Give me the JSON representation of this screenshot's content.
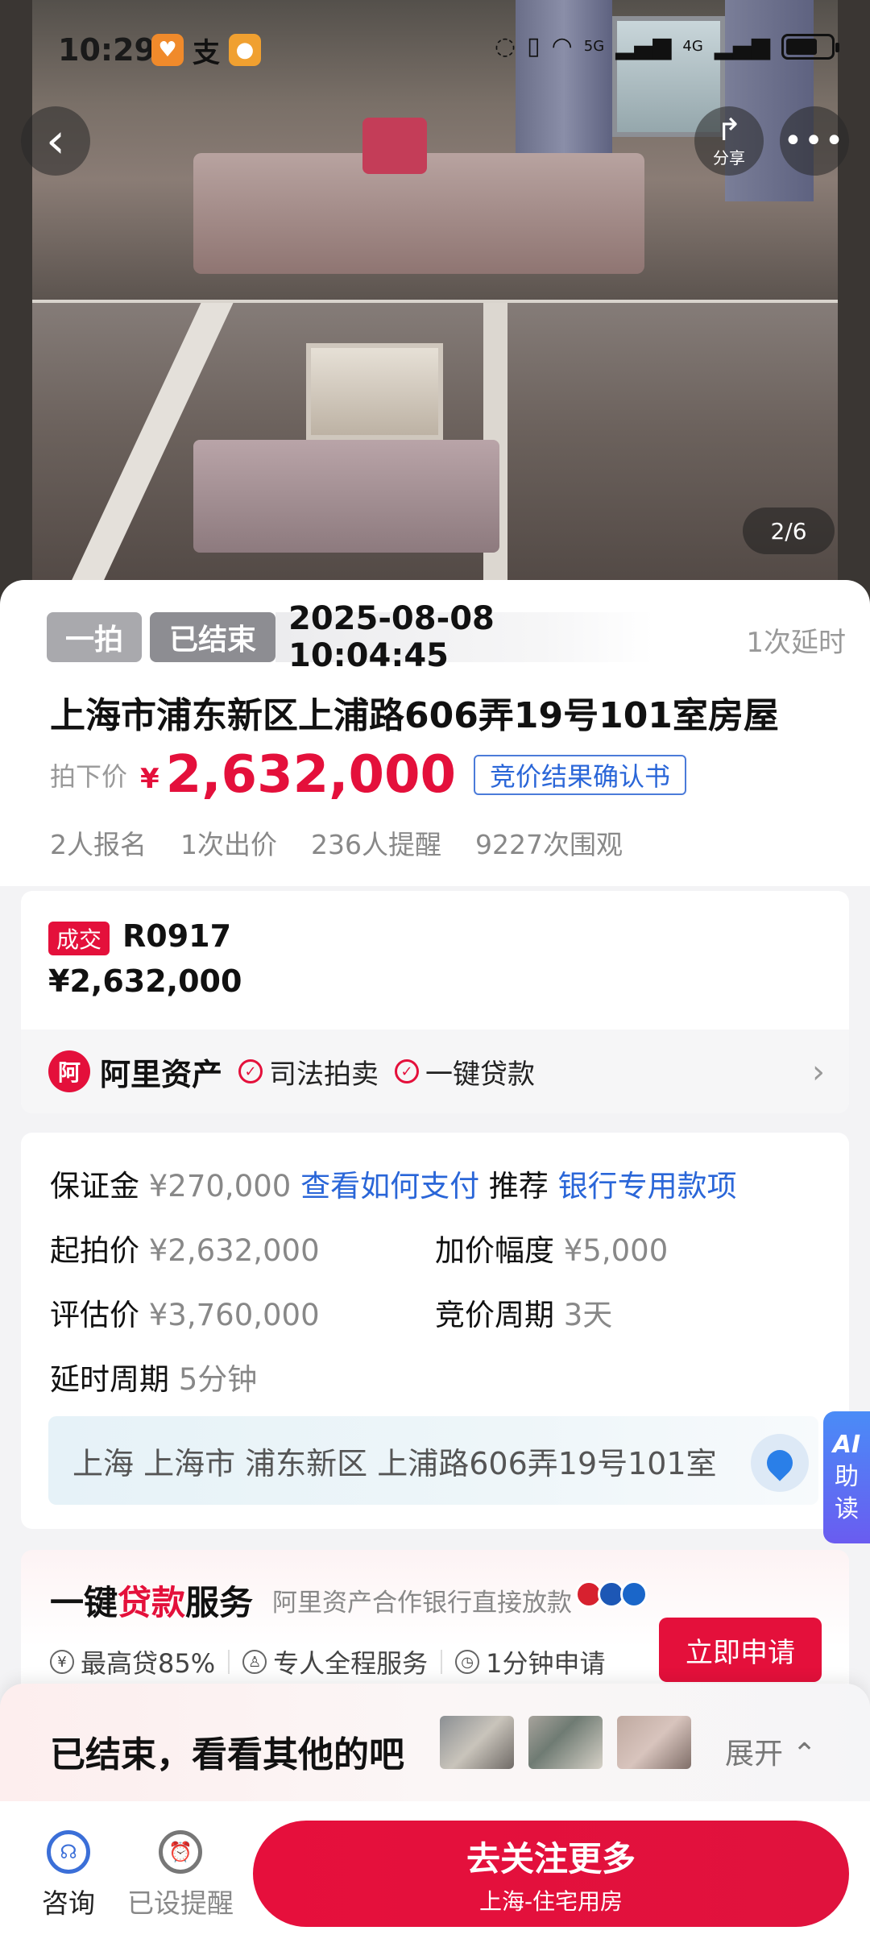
{
  "status_bar": {
    "time": "10:29",
    "network_1": "5G",
    "network_2": "4G"
  },
  "hero": {
    "pager": "2/6",
    "share_label": "分享"
  },
  "auction": {
    "tag_type": "一拍",
    "tag_status": "已结束",
    "end_time": "2025-08-08 10:04:45",
    "delay_count": "1次延时",
    "title": "上海市浦东新区上浦路606弄19号101室房屋",
    "price_label": "拍下价",
    "currency": "¥",
    "price": "2,632,000",
    "cert_label": "竞价结果确认书",
    "stats": [
      "2人报名",
      "1次出价",
      "236人提醒",
      "9227次围观"
    ]
  },
  "deal": {
    "badge": "成交",
    "code": "R0917",
    "price": "¥2,632,000"
  },
  "ali": {
    "logo_text": "阿",
    "name": "阿里资产",
    "features": [
      "司法拍卖",
      "一键贷款"
    ]
  },
  "details": {
    "deposit_label": "保证金",
    "deposit_value": "¥270,000",
    "how_pay": "查看如何支付",
    "recommend_label": "推荐",
    "recommend_link": "银行专用款项",
    "start_label": "起拍价",
    "start_value": "¥2,632,000",
    "increment_label": "加价幅度",
    "increment_value": "¥5,000",
    "appraisal_label": "评估价",
    "appraisal_value": "¥3,760,000",
    "period_label": "竞价周期",
    "period_value": "3天",
    "delay_label": "延时周期",
    "delay_value": "5分钟",
    "address": "上海 上海市 浦东新区 上浦路606弄19号101室"
  },
  "ai_tab": {
    "l1": "AI",
    "l2": "助",
    "l3": "读"
  },
  "loan": {
    "title_a": "一键",
    "title_b": "贷款",
    "title_c": "服务",
    "subtitle": "阿里资产合作银行直接放款",
    "features": [
      "最高贷85%",
      "专人全程服务",
      "1分钟申请"
    ],
    "apply_button": "立即申请"
  },
  "ended": {
    "title": "已结束，看看其他的吧",
    "expand": "展开"
  },
  "bottom_bar": {
    "consult": "咨询",
    "reminded": "已设提醒",
    "follow_title": "去关注更多",
    "follow_sub": "上海-住宅用房"
  },
  "colors": {
    "accent": "#e4103b",
    "link": "#2a66d8"
  }
}
